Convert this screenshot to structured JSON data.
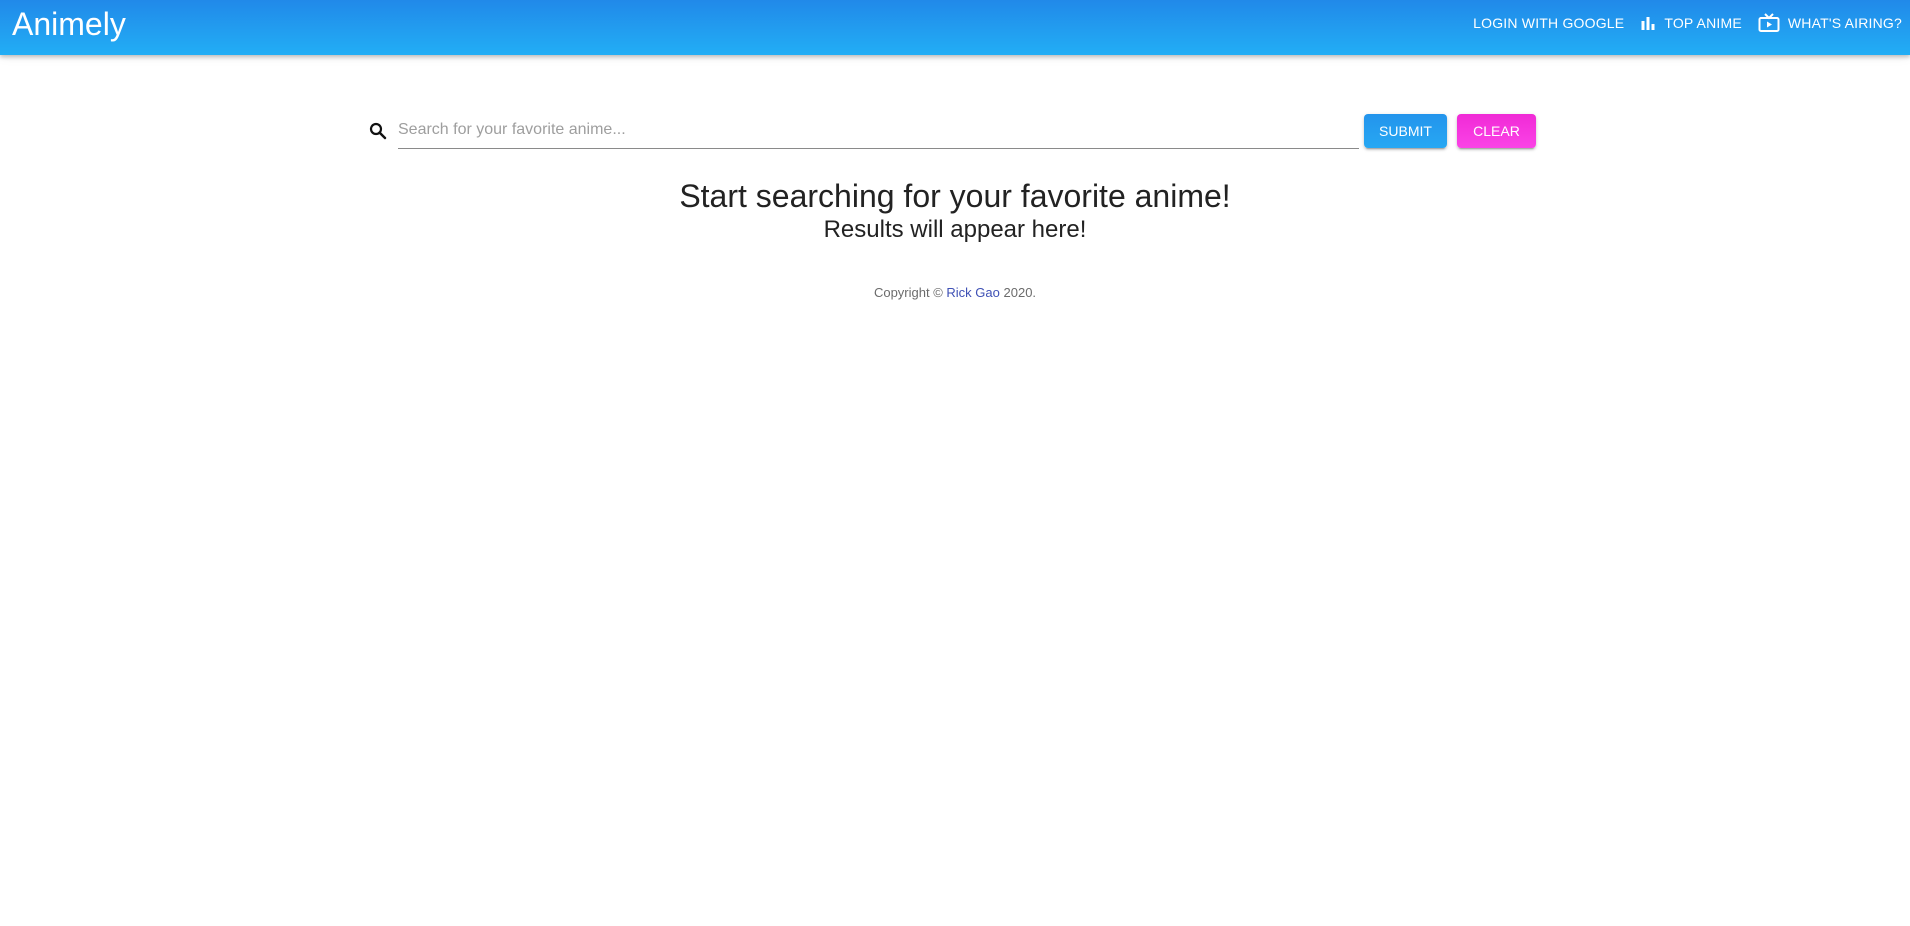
{
  "app": {
    "title": "Animely"
  },
  "nav": {
    "login_label": "LOGIN WITH GOOGLE",
    "top_anime_label": "TOP ANIME",
    "top_anime_icon": "bar-chart-icon",
    "airing_label": "WHAT'S AIRING?",
    "airing_icon": "tv-icon"
  },
  "search": {
    "placeholder": "Search for your favorite anime...",
    "value": "",
    "icon": "search-icon",
    "submit_label": "SUBMIT",
    "clear_label": "CLEAR"
  },
  "empty_state": {
    "headline": "Start searching for your favorite anime!",
    "subline": "Results will appear here!"
  },
  "footer": {
    "prefix": "Copyright ©",
    "author": "Rick Gao",
    "year_suffix": "2020."
  },
  "colors": {
    "appbar_top": "#2189e9",
    "appbar_bottom": "#22aef5",
    "submit": "#2394ec",
    "clear": "#f02ad6",
    "link": "#3f51b5"
  }
}
